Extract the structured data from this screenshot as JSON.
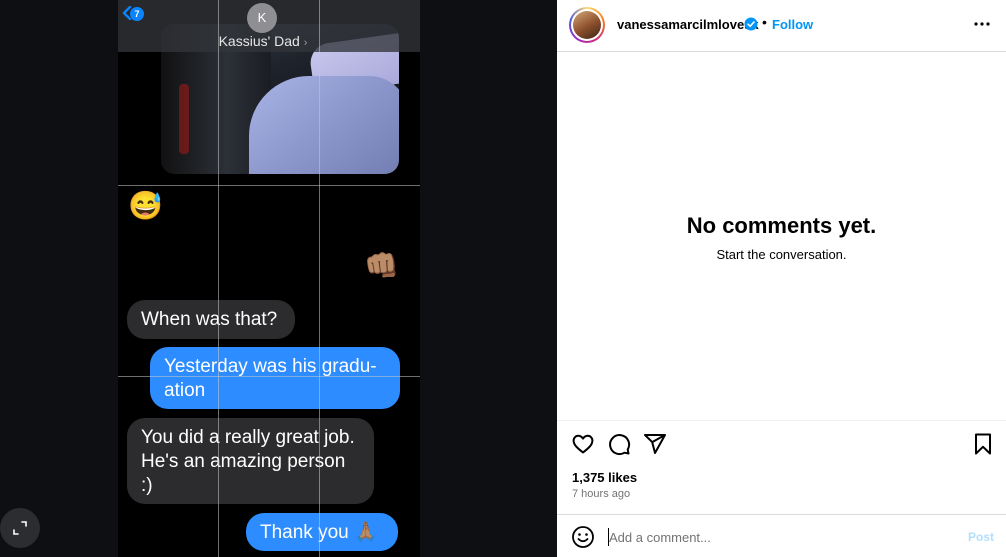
{
  "media": {
    "contact": {
      "initial": "K",
      "name": "Kassius' Dad",
      "name_chevron": "›",
      "back_badge": "7"
    },
    "emojis": {
      "sweat": "😅",
      "fist": "👊🏽"
    },
    "messages": [
      {
        "direction": "incoming",
        "text": "When was that?"
      },
      {
        "direction": "outgoing",
        "text": "Yesterday was his gradu-ation"
      },
      {
        "direction": "incoming",
        "text": "You did a really great job. He's an amazing person :)"
      },
      {
        "direction": "outgoing",
        "text": "Thank you 🙏🏽"
      }
    ],
    "colors": {
      "incoming_bubble": "#2c2c2e",
      "outgoing_bubble": "#2d8cff",
      "background": "#000000"
    },
    "expand_icon": "expand-icon"
  },
  "post": {
    "username": "vanessamarcilmlovesk",
    "verified": true,
    "separator": "•",
    "follow_label": "Follow",
    "more_icon": "more-horizontal-icon",
    "comments_empty_title": "No comments yet.",
    "comments_empty_subtitle": "Start the conversation.",
    "actions": [
      "heart-icon",
      "comment-icon",
      "share-icon",
      "bookmark-icon"
    ],
    "likes": "1,375 likes",
    "timestamp": "7 hours ago",
    "comment_placeholder": "Add a comment...",
    "post_label": "Post",
    "colors": {
      "follow": "#0095f6",
      "post_disabled": "#b2dffc",
      "verified": "#0095f6"
    }
  }
}
